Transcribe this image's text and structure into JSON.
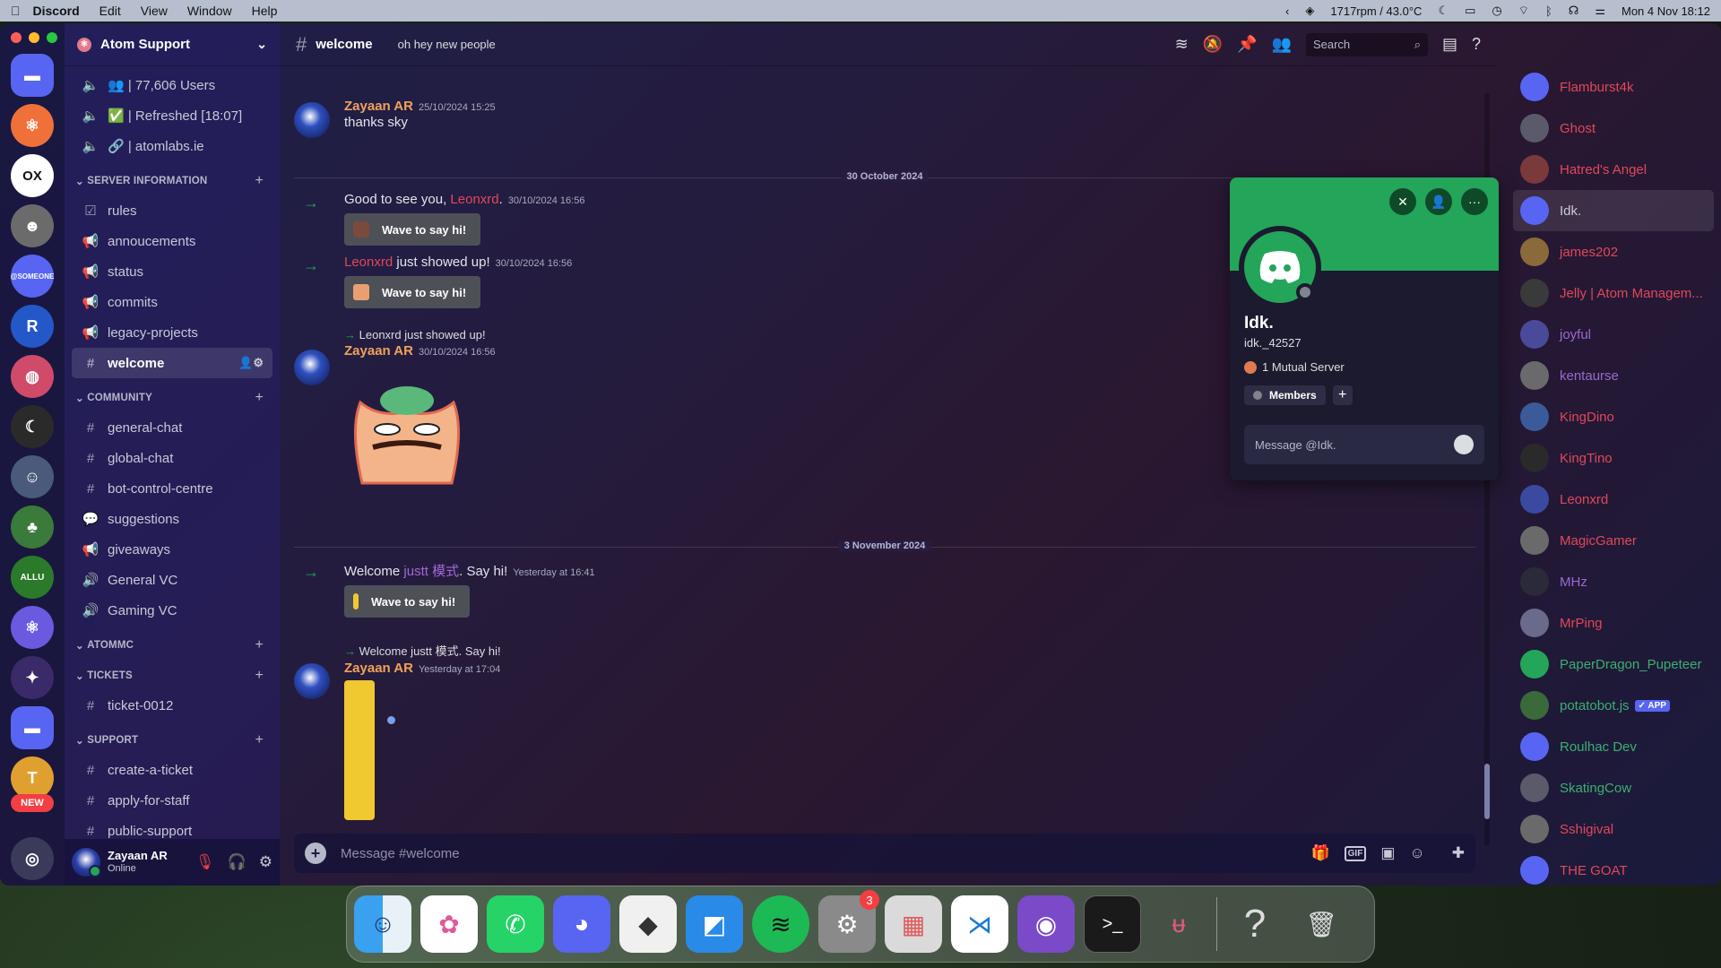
{
  "menubar": {
    "app": "Discord",
    "items": [
      "Edit",
      "View",
      "Window",
      "Help"
    ],
    "right_stats": "1717rpm / 43.0°C",
    "datetime": "Mon 4 Nov  18:12"
  },
  "server": {
    "name": "Atom Support",
    "new_badge": "NEW"
  },
  "channels": {
    "top": [
      {
        "label": "👥 | 77,606 Users"
      },
      {
        "label": "✅ | Refreshed [18:07]"
      },
      {
        "label": "🔗 | atomlabs.ie"
      }
    ],
    "categories": [
      {
        "name": "SERVER INFORMATION",
        "items": [
          {
            "icon": "☑",
            "label": "rules"
          },
          {
            "icon": "📢",
            "label": "annoucements"
          },
          {
            "icon": "📢",
            "label": "status"
          },
          {
            "icon": "📢",
            "label": "commits"
          },
          {
            "icon": "📢",
            "label": "legacy-projects"
          },
          {
            "icon": "#",
            "label": "welcome",
            "selected": true
          }
        ]
      },
      {
        "name": "COMMUNITY",
        "items": [
          {
            "icon": "#",
            "label": "general-chat"
          },
          {
            "icon": "#",
            "label": "global-chat"
          },
          {
            "icon": "#",
            "label": "bot-control-centre"
          },
          {
            "icon": "💬",
            "label": "suggestions"
          },
          {
            "icon": "📢",
            "label": "giveaways"
          },
          {
            "icon": "🔊",
            "label": "General VC"
          },
          {
            "icon": "🔊",
            "label": "Gaming VC"
          }
        ]
      },
      {
        "name": "ATOMMC",
        "items": []
      },
      {
        "name": "TICKETS",
        "items": [
          {
            "icon": "#",
            "label": "ticket-0012"
          }
        ]
      },
      {
        "name": "SUPPORT",
        "items": [
          {
            "icon": "#",
            "label": "create-a-ticket"
          },
          {
            "icon": "#",
            "label": "apply-for-staff"
          },
          {
            "icon": "#",
            "label": "public-support"
          }
        ]
      }
    ]
  },
  "user": {
    "name": "Zayaan AR",
    "status": "Online"
  },
  "chat": {
    "channel": "welcome",
    "topic": "oh hey new people",
    "search_placeholder": "Search",
    "composer_placeholder": "Message #welcome",
    "messages": {
      "m1": {
        "author": "Zayaan AR",
        "time": "25/10/2024 15:25",
        "text": "thanks sky"
      },
      "d1": "30 October 2024",
      "j1": {
        "pre": "Good to see you, ",
        "name": "Leonxrd",
        "post": ".",
        "time": "30/10/2024 16:56",
        "wave": "Wave to say hi!"
      },
      "j2": {
        "name": "Leonxrd",
        "post": " just showed up!",
        "time": "30/10/2024 16:56",
        "wave": "Wave to say hi!"
      },
      "m2": {
        "reply": "Leonxrd just showed up!",
        "author": "Zayaan AR",
        "time": "30/10/2024 16:56"
      },
      "d2": "3 November 2024",
      "j3": {
        "pre": "Welcome ",
        "name": "justt 模式",
        "post": ". Say hi!",
        "time": "Yesterday at 16:41",
        "wave": "Wave to say hi!"
      },
      "m3": {
        "reply": "Welcome justt 模式. Say hi!",
        "author": "Zayaan AR",
        "time": "Yesterday at 17:04"
      }
    }
  },
  "members": [
    {
      "name": "Flamburst4k",
      "color": "#e0485a"
    },
    {
      "name": "Ghost",
      "color": "#e0485a"
    },
    {
      "name": "Hatred's Angel",
      "color": "#e0485a"
    },
    {
      "name": "Idk.",
      "color": "#c8c9d8",
      "selected": true
    },
    {
      "name": "james202",
      "color": "#e0485a"
    },
    {
      "name": "Jelly | Atom Managem...",
      "color": "#e0485a"
    },
    {
      "name": "joyful",
      "color": "#9a6ad0"
    },
    {
      "name": "kentaurse",
      "color": "#9a6ad0"
    },
    {
      "name": "KingDino",
      "color": "#e0485a"
    },
    {
      "name": "KingTino",
      "color": "#e0485a"
    },
    {
      "name": "Leonxrd",
      "color": "#e0485a"
    },
    {
      "name": "MagicGamer",
      "color": "#e0485a"
    },
    {
      "name": "MHz",
      "color": "#9a6ad0"
    },
    {
      "name": "MrPing",
      "color": "#e0485a"
    },
    {
      "name": "PaperDragon_Pupeteer",
      "color": "#3ab070"
    },
    {
      "name": "potatobot.js",
      "color": "#3ab070",
      "tag": "✓ APP"
    },
    {
      "name": "Roulhac Dev",
      "color": "#3ab070"
    },
    {
      "name": "SkatingCow",
      "color": "#3ab070"
    },
    {
      "name": "Sshigival",
      "color": "#e0485a"
    },
    {
      "name": "THE GOAT",
      "color": "#e0485a"
    }
  ],
  "profile": {
    "name": "Idk.",
    "username": "idk._42527",
    "mutual": "1 Mutual Server",
    "role": "Members",
    "message_placeholder": "Message @Idk."
  },
  "dock": {
    "settings_badge": "3"
  },
  "colors": {
    "accent": "#5865f2",
    "online": "#23a55a",
    "banner": "#23a55a"
  }
}
